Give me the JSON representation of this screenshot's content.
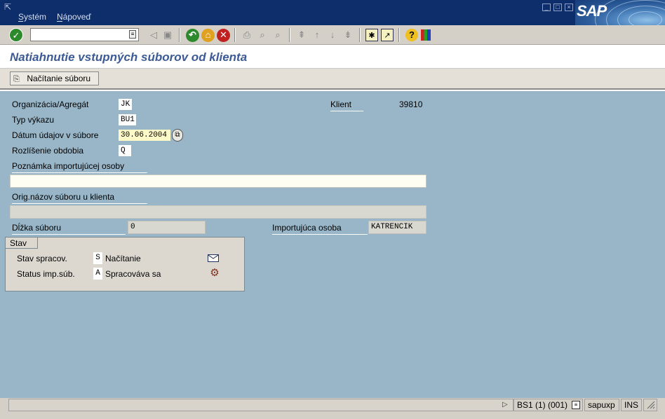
{
  "menu": {
    "system": "Systém",
    "system_key": "S",
    "help": "Nápoveď",
    "help_key": "N"
  },
  "logo": {
    "text": "SAP"
  },
  "toolbar": {
    "command_value": "",
    "icons": [
      "check-icon",
      "dropdown-history-icon",
      "back-arrow-icon",
      "save-icon",
      "back-icon",
      "exit-icon",
      "cancel-icon",
      "print-icon",
      "find-icon",
      "find-next-icon",
      "first-page-icon",
      "prev-page-icon",
      "next-page-icon",
      "last-page-icon",
      "new-session-icon",
      "shortcut-icon",
      "help-icon",
      "layout-icon"
    ]
  },
  "page": {
    "title": "Natiahnutie vstupných súborov od klienta"
  },
  "app_toolbar": {
    "load_button": "Načítanie súboru"
  },
  "form": {
    "org_label": "Organizácia/Agregát",
    "org_value": "JK",
    "type_label": "Typ výkazu",
    "type_value": "BU1",
    "date_label": "Dátum údajov v súbore",
    "date_value": "30.06.2004",
    "period_label": "Rozlíšenie obdobia",
    "period_value": "Q",
    "client_label": "Klient",
    "client_value": "39810",
    "note_label": "Poznámka importujúcej osoby",
    "note_value": "",
    "orig_label": "Orig.názov súboru u klienta",
    "orig_value": "",
    "size_label": "Dĺžka súboru",
    "size_value": "0",
    "importer_label": "Importujúca osoba",
    "importer_value": "KATRENCIK"
  },
  "stav": {
    "tab_label": "Stav",
    "row1_label": "Stav spracov.",
    "row1_code": "S",
    "row1_text": "Načítanie",
    "row2_label": "Status imp.súb.",
    "row2_code": "A",
    "row2_text": "Spracováva sa"
  },
  "status_bar": {
    "system": "BS1 (1) (001)",
    "server": "sapuxp",
    "mode": "INS"
  },
  "colors": {
    "menubar": "#0d2d6b",
    "content_bg": "#98b6c8",
    "title_text": "#3c5a96"
  }
}
